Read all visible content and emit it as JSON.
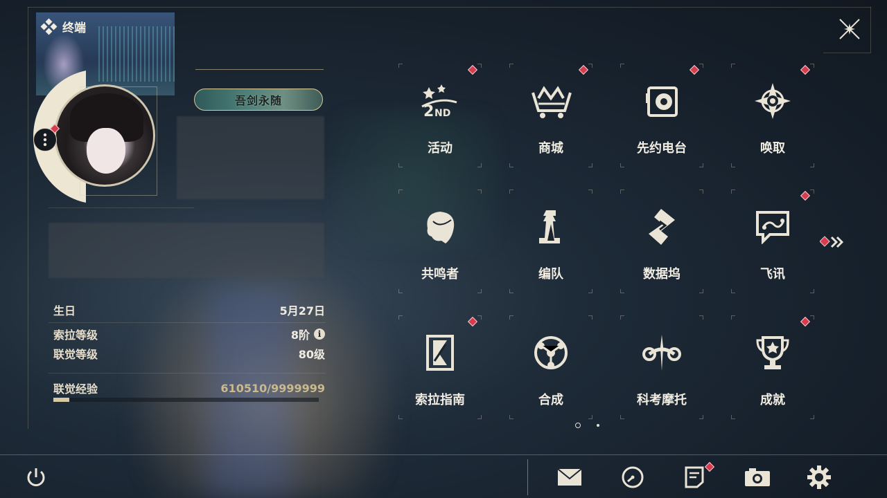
{
  "header": {
    "title": "终端",
    "icon": "diamond-cluster-icon"
  },
  "profile": {
    "title_badge": "吾剑永随",
    "info": {
      "birthday_label": "生日",
      "birthday_value": "5月27日",
      "sola_level_label": "索拉等级",
      "sola_level_value": "8阶",
      "union_level_label": "联觉等级",
      "union_level_value": "80级",
      "union_exp_label": "联觉经验",
      "union_exp_value": "610510/9999999",
      "union_exp_progress": 0.061
    }
  },
  "menu": [
    {
      "label": "活动",
      "icon": "event-2nd-icon",
      "badge": true
    },
    {
      "label": "商城",
      "icon": "shop-cart-icon",
      "badge": true
    },
    {
      "label": "先约电台",
      "icon": "radio-icon",
      "badge": true
    },
    {
      "label": "唤取",
      "icon": "convene-compass-icon",
      "badge": true
    },
    {
      "label": "共鸣者",
      "icon": "resonator-head-icon",
      "badge": false
    },
    {
      "label": "编队",
      "icon": "team-chess-icon",
      "badge": false
    },
    {
      "label": "数据坞",
      "icon": "data-dock-icon",
      "badge": false
    },
    {
      "label": "飞讯",
      "icon": "message-chat-icon",
      "badge": true
    },
    {
      "label": "索拉指南",
      "icon": "guidebook-icon",
      "badge": true
    },
    {
      "label": "合成",
      "icon": "synthesis-icon",
      "badge": false
    },
    {
      "label": "科考摩托",
      "icon": "motorbike-icon",
      "badge": false
    },
    {
      "label": "成就",
      "icon": "trophy-icon",
      "badge": true
    }
  ],
  "pagination": {
    "current": 1,
    "total": 2
  },
  "bottom_bar": [
    {
      "name": "mail",
      "icon": "mail-icon"
    },
    {
      "name": "clock",
      "icon": "clock-icon"
    },
    {
      "name": "notes",
      "icon": "notes-icon",
      "badge": true
    },
    {
      "name": "camera",
      "icon": "camera-icon"
    },
    {
      "name": "settings",
      "icon": "gear-icon"
    }
  ],
  "colors": {
    "badge_red": "#d63b4e",
    "accent_gold": "#d7c9a3",
    "text": "#f2ede2"
  }
}
